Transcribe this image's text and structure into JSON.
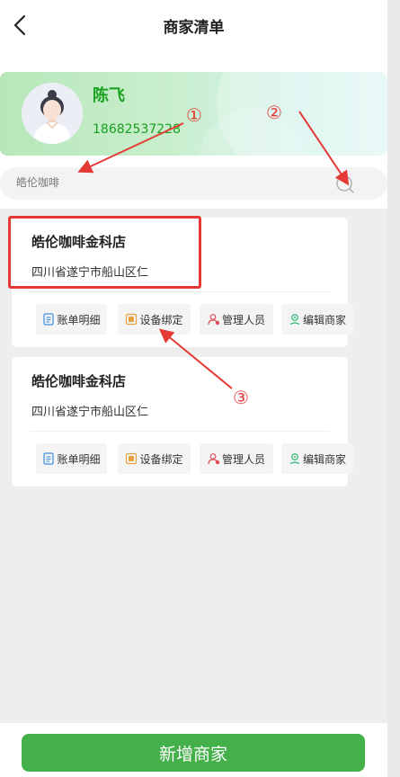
{
  "header": {
    "title": "商家清单"
  },
  "profile": {
    "name": "陈飞",
    "phone": "18682537228"
  },
  "search": {
    "placeholder": "皓伦咖啡"
  },
  "shops": [
    {
      "name": "皓伦咖啡金科店",
      "address": "四川省遂宁市船山区仁",
      "actions": [
        "账单明细",
        "设备绑定",
        "管理人员",
        "编辑商家"
      ]
    },
    {
      "name": "皓伦咖啡金科店",
      "address": "四川省遂宁市船山区仁",
      "actions": [
        "账单明细",
        "设备绑定",
        "管理人员",
        "编辑商家"
      ]
    }
  ],
  "bottom": {
    "add_label": "新增商家"
  },
  "annotations": {
    "m1": "①",
    "m2": "②",
    "m3": "③"
  },
  "colors": {
    "brand_green": "#43b049",
    "name_green": "#1aa01f",
    "annotation_red": "#e53935"
  },
  "icons": [
    "chevron-left-icon",
    "search-icon",
    "bill-icon",
    "device-icon",
    "staff-icon",
    "edit-shop-icon"
  ]
}
